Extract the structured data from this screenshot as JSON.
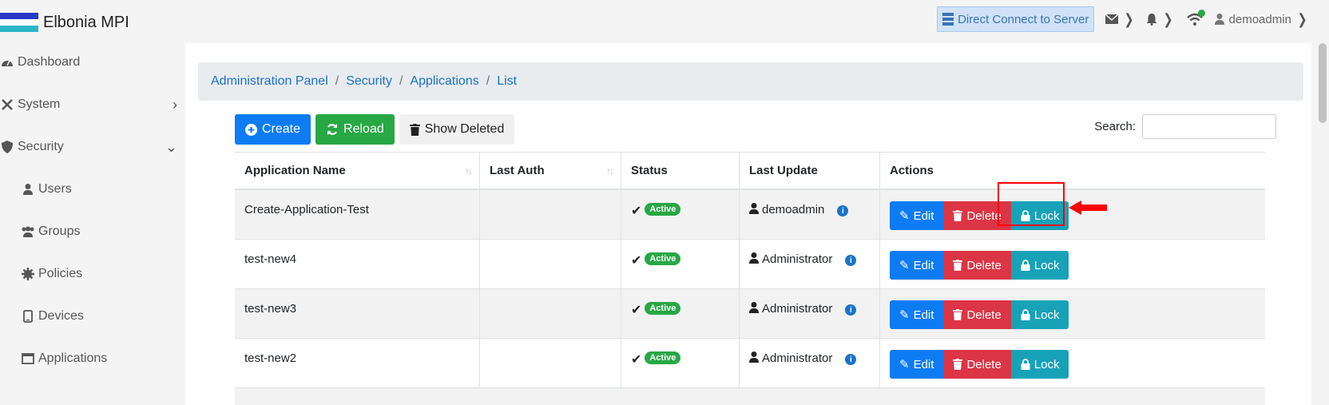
{
  "app": {
    "name": "Elbonia MPI",
    "flag_colors": [
      "#2b39c8",
      "#ffffff",
      "#2bb5c8"
    ]
  },
  "topbar": {
    "direct_connect": "Direct Connect to Server",
    "user": "demoadmin",
    "icons": [
      "server-icon",
      "mail-icon",
      "bell-icon",
      "wifi-icon",
      "user-icon"
    ]
  },
  "sidebar": {
    "items": [
      {
        "label": "Dashboard",
        "icon": "dashboard-icon"
      },
      {
        "label": "System",
        "icon": "tools-icon",
        "arrow": "›"
      },
      {
        "label": "Security",
        "icon": "shield-icon",
        "arrow": "⌄"
      },
      {
        "label": "Users",
        "icon": "user-icon"
      },
      {
        "label": "Groups",
        "icon": "users-icon"
      },
      {
        "label": "Policies",
        "icon": "gear-icon"
      },
      {
        "label": "Devices",
        "icon": "tablet-icon"
      },
      {
        "label": "Applications",
        "icon": "window-icon"
      }
    ]
  },
  "breadcrumb": [
    "Administration Panel",
    "Security",
    "Applications",
    "List"
  ],
  "toolbar": {
    "create": "Create",
    "reload": "Reload",
    "show_deleted": "Show Deleted"
  },
  "search": {
    "label": "Search:",
    "value": ""
  },
  "table": {
    "columns": [
      "Application Name",
      "Last Auth",
      "Status",
      "Last Update",
      "Actions"
    ],
    "rows": [
      {
        "name": "Create-Application-Test",
        "last_auth": "",
        "status": "Active",
        "last_update": "demoadmin"
      },
      {
        "name": "test-new4",
        "last_auth": "",
        "status": "Active",
        "last_update": "Administrator"
      },
      {
        "name": "test-new3",
        "last_auth": "",
        "status": "Active",
        "last_update": "Administrator"
      },
      {
        "name": "test-new2",
        "last_auth": "",
        "status": "Active",
        "last_update": "Administrator"
      }
    ],
    "actions": {
      "edit": "Edit",
      "delete": "Delete",
      "lock": "Lock"
    }
  },
  "colors": {
    "primary": "#0d7cf2",
    "success": "#28a745",
    "danger": "#dc3545",
    "info": "#17a2b8",
    "highlight": "#ff0000"
  }
}
